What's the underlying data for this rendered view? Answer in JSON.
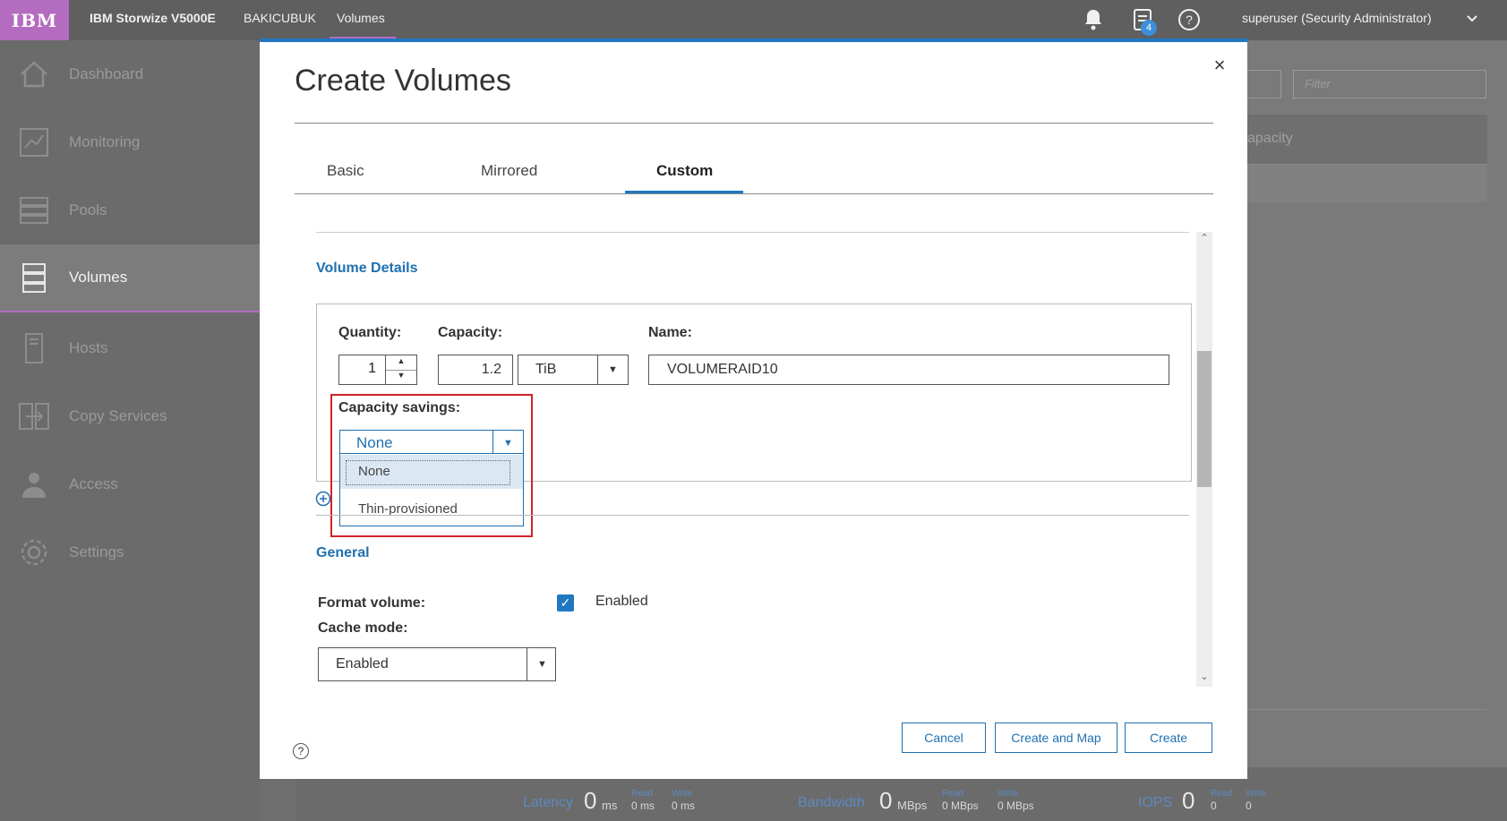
{
  "topbar": {
    "logo": "IBM",
    "product": "IBM Storwize V5000E",
    "system": "BAKICUBUK",
    "page": "Volumes",
    "tasks_badge": "4",
    "user": "superuser (Security Administrator)"
  },
  "sidebar": {
    "items": [
      {
        "label": "Dashboard",
        "icon": "dashboard-icon"
      },
      {
        "label": "Monitoring",
        "icon": "monitoring-icon"
      },
      {
        "label": "Pools",
        "icon": "pools-icon"
      },
      {
        "label": "Volumes",
        "icon": "volumes-icon",
        "active": true
      },
      {
        "label": "Hosts",
        "icon": "hosts-icon"
      },
      {
        "label": "Copy Services",
        "icon": "copy-services-icon"
      },
      {
        "label": "Access",
        "icon": "access-icon"
      },
      {
        "label": "Settings",
        "icon": "settings-icon"
      }
    ]
  },
  "background": {
    "filter_placeholder": "Filter",
    "column_header": "apacity"
  },
  "dialog": {
    "title": "Create Volumes",
    "close": "×",
    "tabs": [
      "Basic",
      "Mirrored",
      "Custom"
    ],
    "active_tab": "Custom",
    "volume_details": {
      "heading": "Volume Details",
      "quantity_label": "Quantity:",
      "quantity_value": "1",
      "capacity_label": "Capacity:",
      "capacity_value": "1.2",
      "capacity_unit": "TiB",
      "name_label": "Name:",
      "name_value": "VOLUMERAID10",
      "savings_label": "Capacity savings:",
      "savings_value": "None",
      "savings_options": [
        "None",
        "Thin-provisioned"
      ]
    },
    "general": {
      "heading": "General",
      "format_label": "Format volume:",
      "format_checked": true,
      "format_value": "Enabled",
      "cache_label": "Cache mode:",
      "cache_value": "Enabled"
    },
    "buttons": {
      "cancel": "Cancel",
      "create_and_map": "Create and Map",
      "create": "Create"
    },
    "help": "?"
  },
  "status": {
    "latency": {
      "label": "Latency",
      "value": "0",
      "unit": "ms",
      "read_label": "Read",
      "read": "0 ms",
      "write_label": "Write",
      "write": "0 ms"
    },
    "bandwidth": {
      "label": "Bandwidth",
      "value": "0",
      "unit": "MBps",
      "read_label": "Read",
      "read": "0 MBps",
      "write_label": "Write",
      "write": "0 MBps"
    },
    "iops": {
      "label": "IOPS",
      "value": "0",
      "read_label": "Read",
      "read": "0",
      "write_label": "Write",
      "write": "0"
    }
  },
  "colors": {
    "accent": "#1f78c1",
    "brand": "#b46cc0",
    "highlight_box": "#d1232a"
  }
}
